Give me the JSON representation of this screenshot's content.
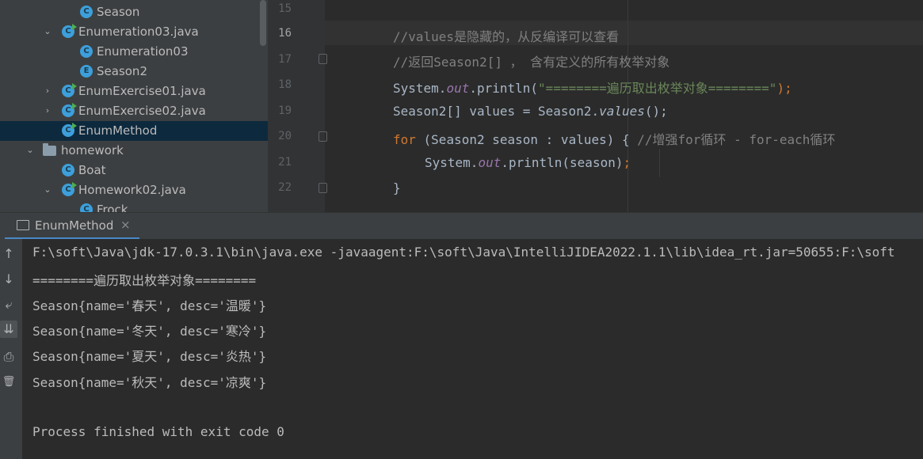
{
  "project_tree": {
    "items": [
      {
        "label": "Season",
        "icon": "class-icon",
        "chevron": ""
      },
      {
        "label": "Enumeration03.java",
        "icon": "java-file-icon",
        "chevron": "expanded"
      },
      {
        "label": "Enumeration03",
        "icon": "class-icon",
        "chevron": ""
      },
      {
        "label": "Season2",
        "icon": "enum-icon",
        "chevron": ""
      },
      {
        "label": "EnumExercise01.java",
        "icon": "java-file-icon",
        "chevron": "collapsed"
      },
      {
        "label": "EnumExercise02.java",
        "icon": "java-file-icon",
        "chevron": "collapsed"
      },
      {
        "label": "EnumMethod",
        "icon": "runnable-class-icon",
        "chevron": "",
        "selected": true
      },
      {
        "label": "homework",
        "icon": "package-icon",
        "chevron": "expanded"
      },
      {
        "label": "Boat",
        "icon": "class-icon",
        "chevron": ""
      },
      {
        "label": "Homework02.java",
        "icon": "java-file-icon",
        "chevron": "expanded"
      },
      {
        "label": "Frock",
        "icon": "class-icon",
        "chevron": ""
      }
    ]
  },
  "editor": {
    "line_numbers": [
      "15",
      "16",
      "17",
      "18",
      "19",
      "20",
      "21",
      "22"
    ],
    "current_line": "16",
    "code": {
      "l16": "//values是隐藏的，从反编译可以查看",
      "l17": "//返回Season2[] ， 含有定义的所有枚举对象",
      "l18_a": "System.",
      "l18_b": "out",
      "l18_c": ".println(",
      "l18_d": "\"========遍历取出枚举对象========\"",
      "l18_e": ");",
      "l19_a": "Season2[] values = Season2.",
      "l19_b": "values",
      "l19_c": "();",
      "l20_a": "for",
      "l20_b": " (Season2 season : values) { ",
      "l20_c": "//增强for循环 - for-each循环",
      "l21_a": "System.",
      "l21_b": "out",
      "l21_c": ".println(season)",
      "l21_d": ";",
      "l22": "}"
    }
  },
  "run_window": {
    "tab_label": "EnumMethod",
    "close_glyph": "×",
    "toolbar": [
      {
        "name": "up-arrow-icon",
        "glyph": "↑"
      },
      {
        "name": "down-arrow-icon",
        "glyph": "↓"
      },
      {
        "name": "soft-wrap-icon",
        "glyph": "⤶"
      },
      {
        "name": "scroll-to-end-icon",
        "glyph": "⇊"
      },
      {
        "name": "print-icon",
        "glyph": "⎙"
      },
      {
        "name": "trash-icon",
        "glyph": "🗑"
      }
    ],
    "output": [
      "F:\\soft\\Java\\jdk-17.0.3.1\\bin\\java.exe -javaagent:F:\\soft\\Java\\IntelliJIDEA2022.1.1\\lib\\idea_rt.jar=50655:F:\\soft",
      "========遍历取出枚举对象========",
      "Season{name='春天', desc='温暖'}",
      "Season{name='冬天', desc='寒冷'}",
      "Season{name='夏天', desc='炎热'}",
      "Season{name='秋天', desc='凉爽'}",
      "",
      "Process finished with exit code 0"
    ]
  }
}
